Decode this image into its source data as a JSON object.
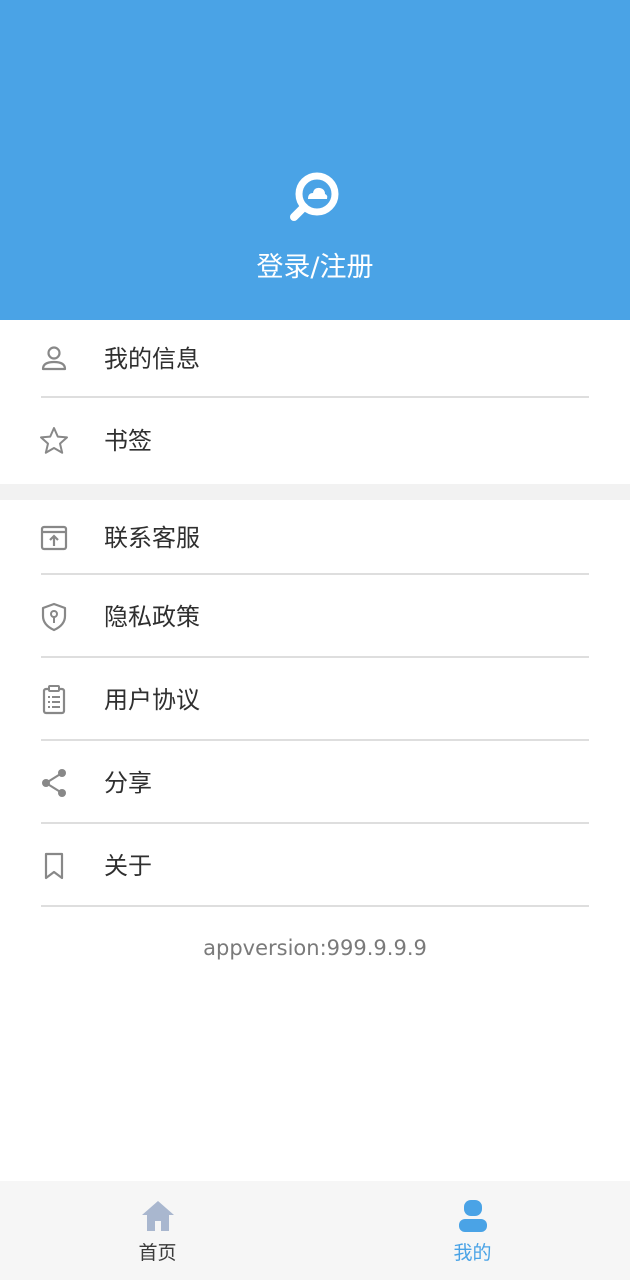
{
  "header": {
    "login_label": "登录/注册",
    "logo_icon": "cloud-search-icon",
    "background_color": "#4aa3e6"
  },
  "section1": {
    "items": [
      {
        "label": "我的信息",
        "icon": "user-icon"
      },
      {
        "label": "书签",
        "icon": "star-icon"
      }
    ]
  },
  "section2": {
    "items": [
      {
        "label": "联系客服",
        "icon": "contact-icon"
      },
      {
        "label": "隐私政策",
        "icon": "shield-icon"
      },
      {
        "label": "用户协议",
        "icon": "clipboard-icon"
      },
      {
        "label": "分享",
        "icon": "share-icon"
      },
      {
        "label": "关于",
        "icon": "bookmark-icon"
      }
    ]
  },
  "version": "appversion:999.9.9.9",
  "bottom_nav": {
    "items": [
      {
        "label": "首页",
        "icon": "home-icon",
        "active": false
      },
      {
        "label": "我的",
        "icon": "profile-icon",
        "active": true
      }
    ],
    "active_color": "#4aa3e6",
    "inactive_color": "#3a3a3a"
  }
}
